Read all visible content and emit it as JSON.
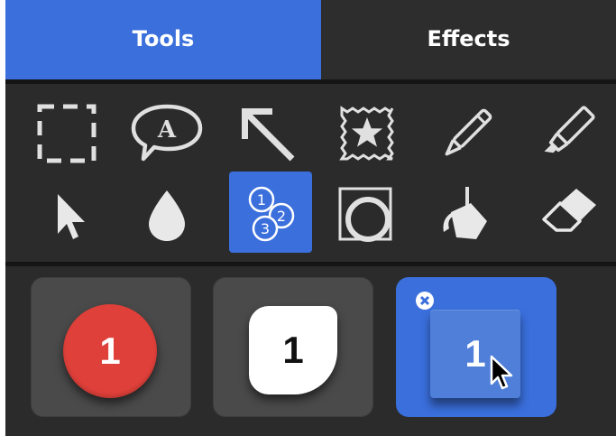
{
  "tabs": [
    {
      "label": "Tools",
      "active": true
    },
    {
      "label": "Effects",
      "active": false
    }
  ],
  "tools": [
    {
      "name": "rectangle-select-icon"
    },
    {
      "name": "speech-bubble-text-icon",
      "glyph": "A"
    },
    {
      "name": "arrow-icon"
    },
    {
      "name": "stamp-icon"
    },
    {
      "name": "pen-icon"
    },
    {
      "name": "highlighter-icon"
    },
    {
      "name": "pointer-icon"
    },
    {
      "name": "blur-drop-icon"
    },
    {
      "name": "counter-icon",
      "selected": true,
      "glyphs": [
        "1",
        "2",
        "3"
      ]
    },
    {
      "name": "shape-icon"
    },
    {
      "name": "fill-bucket-icon"
    },
    {
      "name": "eraser-icon"
    }
  ],
  "counter_styles": [
    {
      "name": "red-circle",
      "label": "1"
    },
    {
      "name": "white-leaf",
      "label": "1"
    },
    {
      "name": "blue-square",
      "label": "1",
      "selected": true
    }
  ],
  "colors": {
    "accent": "#3a6fdc",
    "panel": "#2b2b2b",
    "tile": "#4a4a4a",
    "badge_red": "#e0403a"
  }
}
